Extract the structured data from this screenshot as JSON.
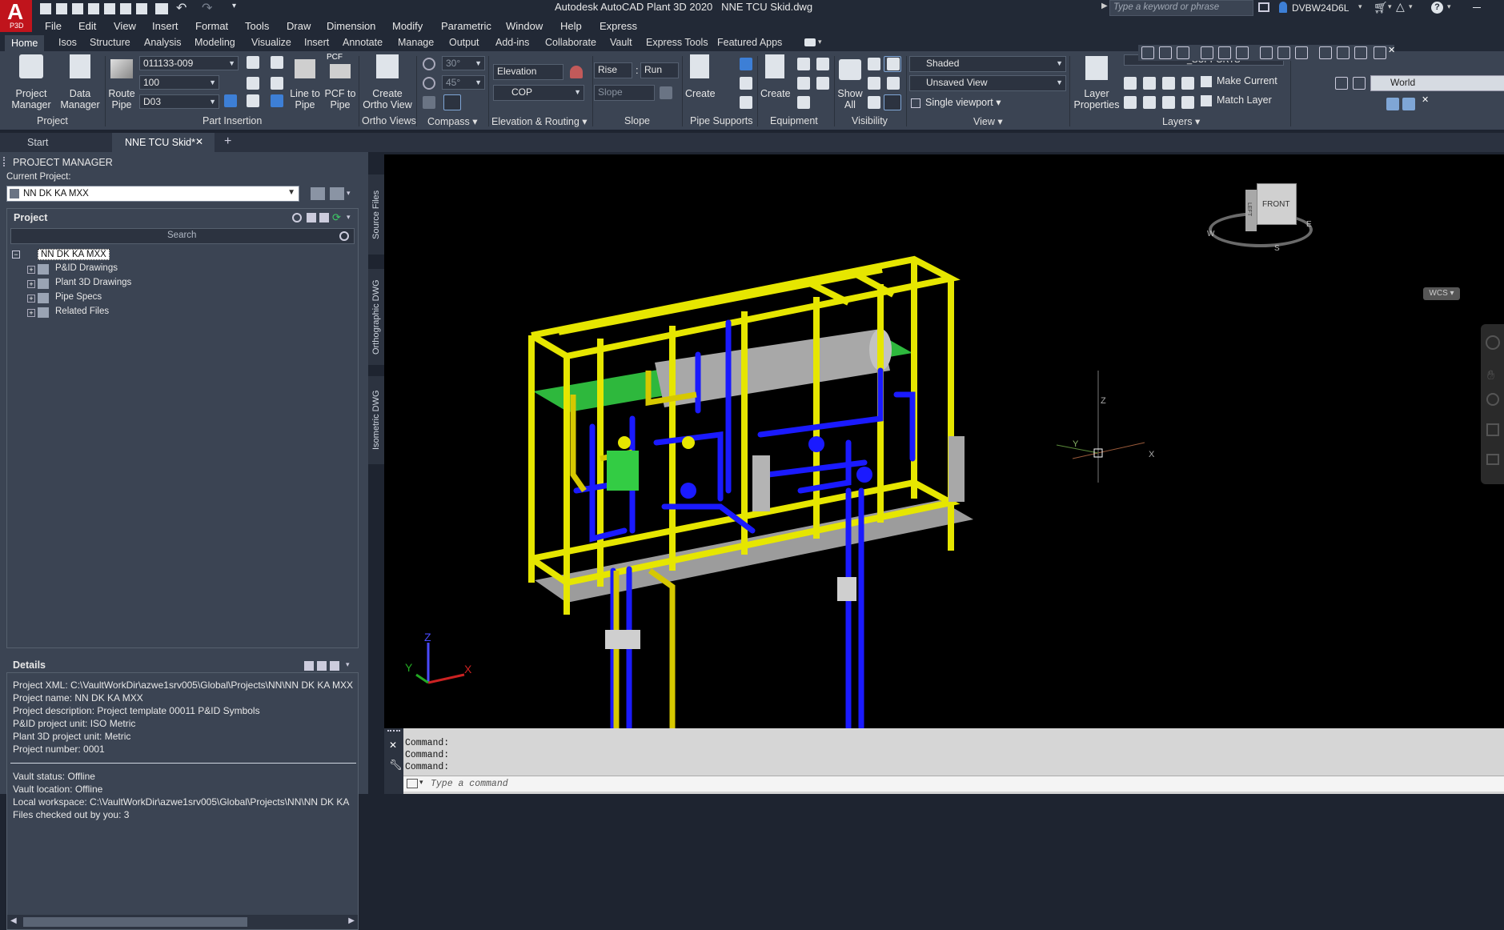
{
  "app": {
    "title": "Autodesk AutoCAD Plant 3D 2020",
    "document": "NNE TCU Skid.dwg",
    "search_placeholder": "Type a keyword or phrase",
    "user": "DVBW24D6L",
    "logo_letter": "A",
    "logo_sub": "P3D"
  },
  "menu": [
    "File",
    "Edit",
    "View",
    "Insert",
    "Format",
    "Tools",
    "Draw",
    "Dimension",
    "Modify",
    "Parametric",
    "Window",
    "Help",
    "Express"
  ],
  "ribbon_tabs": [
    "Home",
    "Isos",
    "Structure",
    "Analysis",
    "Modeling",
    "Visualize",
    "Insert",
    "Annotate",
    "Manage",
    "Output",
    "Add-ins",
    "Collaborate",
    "Vault",
    "Express Tools",
    "Featured Apps"
  ],
  "ribbon": {
    "project": {
      "title": "Project",
      "pm": "Project Manager",
      "dm": "Data Manager"
    },
    "part": {
      "title": "Part Insertion",
      "route": "Route Pipe",
      "spec": "011133-009",
      "size": "100",
      "layer": "D03",
      "line": "Line to Pipe",
      "pcf": "PCF to Pipe",
      "pcf_badge": "PCF"
    },
    "ortho": {
      "title": "Ortho Views",
      "create": "Create Ortho View"
    },
    "compass": {
      "title": "Compass",
      "a1": "30°",
      "a2": "45°"
    },
    "elev": {
      "title": "Elevation & Routing",
      "elevation": "Elevation",
      "cop": "COP"
    },
    "slope": {
      "title": "Slope",
      "rise": "Rise",
      "run": "Run",
      "slope": "Slope"
    },
    "supports": {
      "title": "Pipe Supports",
      "create": "Create"
    },
    "equip": {
      "title": "Equipment",
      "create": "Create"
    },
    "vis": {
      "title": "Visibility",
      "show": "Show All"
    },
    "view": {
      "title": "View",
      "style": "Shaded",
      "saved": "Unsaved View",
      "viewport": "Single viewport"
    },
    "layers": {
      "title": "Layers",
      "props": "Layer Properties",
      "current": "_SUPPORTS",
      "make": "Make Current",
      "match": "Match Layer"
    },
    "ucs": {
      "world": "World"
    }
  },
  "doc_tabs": [
    "Start",
    "NNE TCU Skid*"
  ],
  "pm": {
    "header": "PROJECT MANAGER",
    "current_label": "Current Project:",
    "current": "NN DK KA MXX",
    "project_label": "Project",
    "search": "Search",
    "root": "NN DK KA MXX",
    "items": [
      "P&ID Drawings",
      "Plant 3D Drawings",
      "Pipe Specs",
      "Related Files"
    ],
    "details_label": "Details",
    "details": [
      "Project XML: C:\\VaultWorkDir\\azwe1srv005\\Global\\Projects\\NN\\NN DK KA MXX",
      "Project name: NN DK KA MXX",
      "Project description: Project template 00011 P&ID Symbols",
      "P&ID project unit: ISO Metric",
      "Plant 3D project unit: Metric",
      "Project number: 0001"
    ],
    "vault": [
      "Vault status: Offline",
      "Vault location: Offline",
      "Local workspace: C:\\VaultWorkDir\\azwe1srv005\\Global\\Projects\\NN\\NN DK KA",
      "Files checked out by you: 3"
    ],
    "side_tabs": [
      "Source Files",
      "Orthographic DWG",
      "Isometric DWG"
    ]
  },
  "viewport": {
    "cube_face": "FRONT",
    "cube_left": "LEFT",
    "wcs": "WCS",
    "x": "X",
    "y": "Y",
    "z": "Z",
    "compass_w": "W",
    "compass_s": "S",
    "compass_e": "E"
  },
  "cmd": {
    "history": [
      "Command:",
      "Command:",
      "Command:"
    ],
    "placeholder": "Type a command"
  },
  "colors": {
    "frame": "#e6e600",
    "pipe": "#1a1aff",
    "grating": "#33cc44",
    "steel": "#a8a8a8"
  }
}
